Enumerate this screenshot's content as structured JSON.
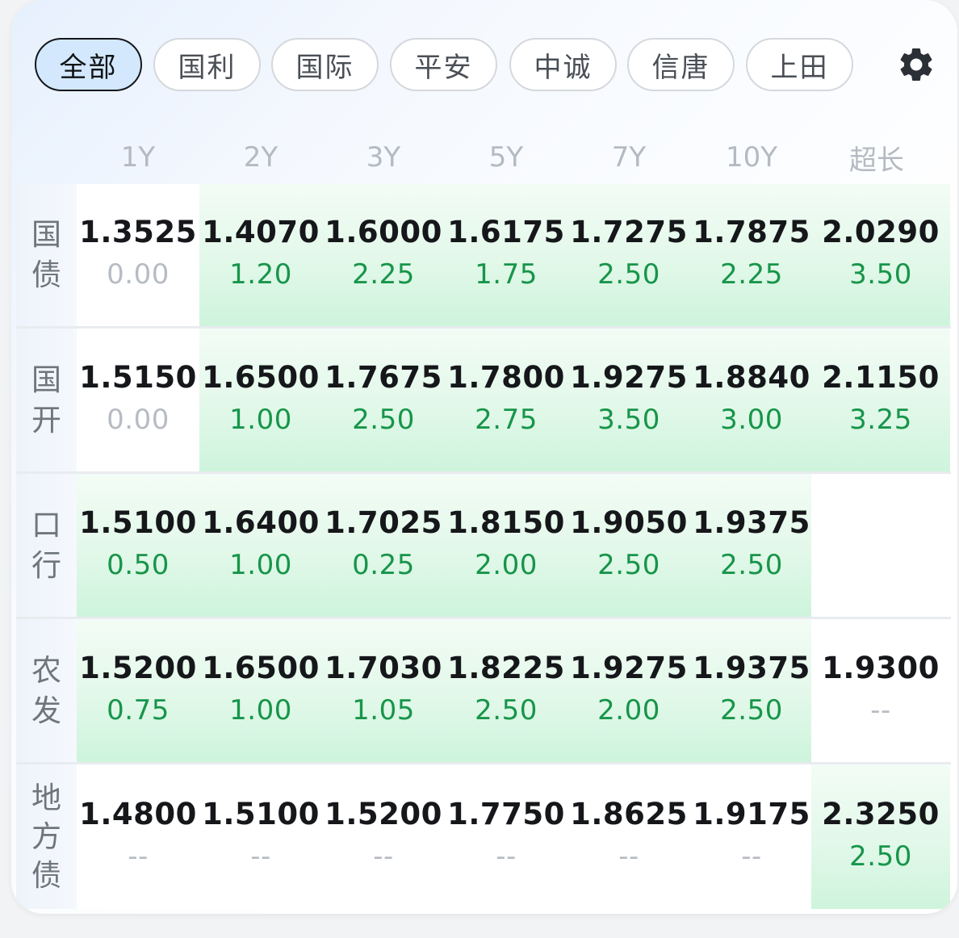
{
  "tabs": [
    {
      "label": "全部",
      "active": true
    },
    {
      "label": "国利",
      "active": false
    },
    {
      "label": "国际",
      "active": false
    },
    {
      "label": "平安",
      "active": false
    },
    {
      "label": "中诚",
      "active": false
    },
    {
      "label": "信唐",
      "active": false
    },
    {
      "label": "上田",
      "active": false
    }
  ],
  "settings_icon": "gear-icon",
  "columns": [
    "1Y",
    "2Y",
    "3Y",
    "5Y",
    "7Y",
    "10Y",
    "超长"
  ],
  "rows": [
    {
      "label_chars": [
        "国",
        "债"
      ],
      "cells": [
        {
          "yield": "1.3525",
          "change": "0.00",
          "state": "zero"
        },
        {
          "yield": "1.4070",
          "change": "1.20",
          "state": "up"
        },
        {
          "yield": "1.6000",
          "change": "2.25",
          "state": "up"
        },
        {
          "yield": "1.6175",
          "change": "1.75",
          "state": "up"
        },
        {
          "yield": "1.7275",
          "change": "2.50",
          "state": "up"
        },
        {
          "yield": "1.7875",
          "change": "2.25",
          "state": "up"
        },
        {
          "yield": "2.0290",
          "change": "3.50",
          "state": "up"
        }
      ]
    },
    {
      "label_chars": [
        "国",
        "开"
      ],
      "cells": [
        {
          "yield": "1.5150",
          "change": "0.00",
          "state": "zero"
        },
        {
          "yield": "1.6500",
          "change": "1.00",
          "state": "up"
        },
        {
          "yield": "1.7675",
          "change": "2.50",
          "state": "up"
        },
        {
          "yield": "1.7800",
          "change": "2.75",
          "state": "up"
        },
        {
          "yield": "1.9275",
          "change": "3.50",
          "state": "up"
        },
        {
          "yield": "1.8840",
          "change": "3.00",
          "state": "up"
        },
        {
          "yield": "2.1150",
          "change": "3.25",
          "state": "up"
        }
      ]
    },
    {
      "label_chars": [
        "口",
        "行"
      ],
      "cells": [
        {
          "yield": "1.5100",
          "change": "0.50",
          "state": "up"
        },
        {
          "yield": "1.6400",
          "change": "1.00",
          "state": "up"
        },
        {
          "yield": "1.7025",
          "change": "0.25",
          "state": "up"
        },
        {
          "yield": "1.8150",
          "change": "2.00",
          "state": "up"
        },
        {
          "yield": "1.9050",
          "change": "2.50",
          "state": "up"
        },
        {
          "yield": "1.9375",
          "change": "2.50",
          "state": "up"
        },
        {
          "yield": "",
          "change": "",
          "state": "empty"
        }
      ]
    },
    {
      "label_chars": [
        "农",
        "发"
      ],
      "cells": [
        {
          "yield": "1.5200",
          "change": "0.75",
          "state": "up"
        },
        {
          "yield": "1.6500",
          "change": "1.00",
          "state": "up"
        },
        {
          "yield": "1.7030",
          "change": "1.05",
          "state": "up"
        },
        {
          "yield": "1.8225",
          "change": "2.50",
          "state": "up"
        },
        {
          "yield": "1.9275",
          "change": "2.00",
          "state": "up"
        },
        {
          "yield": "1.9375",
          "change": "2.50",
          "state": "up"
        },
        {
          "yield": "1.9300",
          "change": "--",
          "state": "dash"
        }
      ]
    },
    {
      "label_chars": [
        "地",
        "方",
        "债"
      ],
      "cells": [
        {
          "yield": "1.4800",
          "change": "--",
          "state": "dash"
        },
        {
          "yield": "1.5100",
          "change": "--",
          "state": "dash"
        },
        {
          "yield": "1.5200",
          "change": "--",
          "state": "dash"
        },
        {
          "yield": "1.7750",
          "change": "--",
          "state": "dash"
        },
        {
          "yield": "1.8625",
          "change": "--",
          "state": "dash"
        },
        {
          "yield": "1.9175",
          "change": "--",
          "state": "dash"
        },
        {
          "yield": "2.3250",
          "change": "2.50",
          "state": "up"
        }
      ]
    }
  ]
}
